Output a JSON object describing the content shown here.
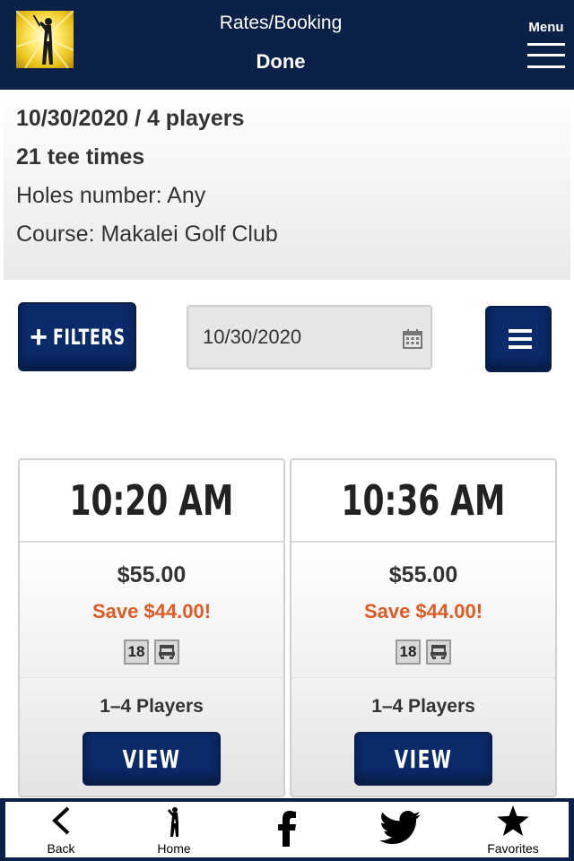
{
  "header": {
    "title": "Rates/Booking",
    "done_label": "Done",
    "menu_label": "Menu"
  },
  "summary": {
    "date_players": "10/30/2020 / 4 players",
    "tee_times": "21 tee times",
    "holes": "Holes number: Any",
    "course": "Course: Makalei Golf Club"
  },
  "toolbar": {
    "filters_label": "FILTERS",
    "date_value": "10/30/2020"
  },
  "tee_times": [
    {
      "time": "10:20 AM",
      "price": "$55.00",
      "save": "Save $44.00!",
      "holes_badge": "18",
      "players": "1–4 Players",
      "view_label": "VIEW"
    },
    {
      "time": "10:36 AM",
      "price": "$55.00",
      "save": "Save $44.00!",
      "holes_badge": "18",
      "players": "1–4 Players",
      "view_label": "VIEW"
    }
  ],
  "bottom_nav": {
    "back": "Back",
    "home": "Home",
    "favorites": "Favorites"
  },
  "colors": {
    "navy": "#0b2147",
    "button_blue": "#0b2a6a",
    "save_orange": "#e05a24"
  },
  "icons": [
    "golfer-logo-icon",
    "hamburger-menu-icon",
    "plus-icon",
    "calendar-icon",
    "list-icon",
    "holes-18-icon",
    "cart-icon",
    "back-chevron-icon",
    "golfer-home-icon",
    "facebook-icon",
    "twitter-icon",
    "star-icon"
  ]
}
